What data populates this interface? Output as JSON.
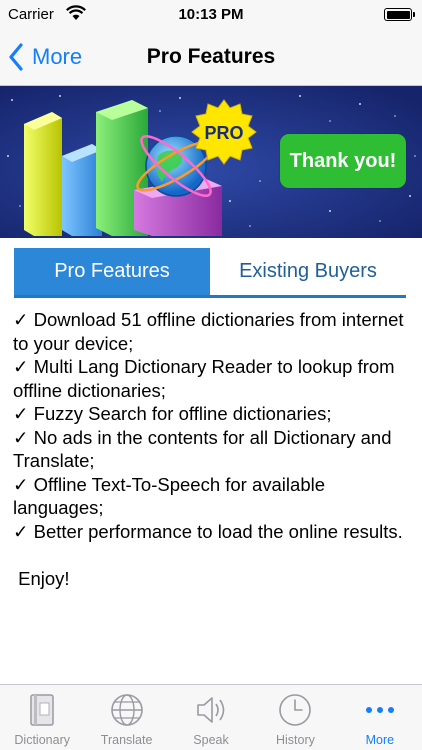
{
  "status_bar": {
    "carrier": "Carrier",
    "time": "10:13 PM"
  },
  "nav": {
    "back_label": "More",
    "title": "Pro Features"
  },
  "banner": {
    "badge": "PRO",
    "thank_button": "Thank you!"
  },
  "tabs": [
    {
      "label": "Pro Features",
      "active": true
    },
    {
      "label": "Existing Buyers",
      "active": false
    }
  ],
  "features": [
    " ✓ Download 51 offline dictionaries from internet to your device;",
    " ✓ Multi Lang Dictionary Reader to lookup from offline dictionaries;",
    " ✓ Fuzzy Search for offline dictionaries;",
    " ✓ No ads in the contents for all Dictionary and Translate;",
    " ✓ Offline Text-To-Speech for available languages;",
    " ✓ Better performance to load the online results."
  ],
  "closing": "Enjoy!",
  "tab_bar": [
    {
      "label": "Dictionary",
      "icon": "dictionary-icon"
    },
    {
      "label": "Translate",
      "icon": "globe-icon"
    },
    {
      "label": "Speak",
      "icon": "speaker-icon"
    },
    {
      "label": "History",
      "icon": "clock-icon"
    },
    {
      "label": "More",
      "icon": "more-icon",
      "active": true
    }
  ],
  "colors": {
    "accent": "#147efb",
    "tab_active": "#2c87d8",
    "thank_button": "#2fbd34",
    "banner_bg": "#1b2d7a"
  }
}
